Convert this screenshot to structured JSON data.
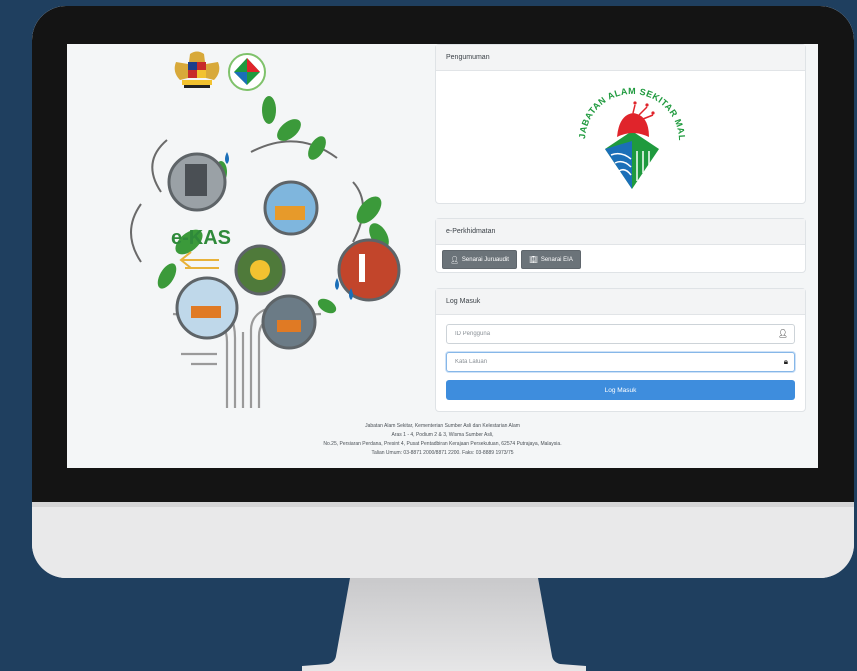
{
  "app": {
    "name": "e-KAS"
  },
  "left": {
    "crest_icon": "malaysia-coat-of-arms-icon",
    "small_logo_icon": "e-kas-logo-icon",
    "illustration": {
      "icon": "e-kas-environment-tree-icon",
      "wordmark": "e-KAS"
    }
  },
  "announcement": {
    "title": "Pengumuman",
    "logo_icon": "jabatan-alam-sekitar-logo-icon",
    "logo_text": "JABATAN ALAM SEKITAR MALAYSIA"
  },
  "services": {
    "title": "e-Perkhidmatan",
    "buttons": [
      {
        "label": "Senarai Juruaudit",
        "icon": "user-icon"
      },
      {
        "label": "Senarai EIA",
        "icon": "building-icon"
      }
    ]
  },
  "login": {
    "title": "Log Masuk",
    "user_placeholder": "ID Pengguna",
    "user_icon": "user-icon",
    "password_placeholder": "Kata Laluan",
    "password_icon": "lock-icon",
    "submit_label": "Log Masuk"
  },
  "footer": {
    "line1": "Jabatan Alam Sekitar, Kementerian Sumber Asli dan Kelestarian Alam",
    "line2": "Aras 1 - 4, Podium 2 & 3, Wisma Sumber Asli,",
    "line3": "No.25, Persiaran Perdana, Presint 4, Pusat Pentadbiran Kerajaan Persekutuan, 62574 Putrajaya, Malaysia.",
    "line4": "Talian Umum: 03-8871 2000/8871 2200. Faks: 03-8889 1973/75"
  },
  "colors": {
    "page_background": "#1f3f5f",
    "login_button": "#3e8ddd",
    "service_button": "#6b7379",
    "jas_red": "#e0242b",
    "jas_green": "#1f9a3e",
    "jas_blue": "#1b6fb8"
  }
}
